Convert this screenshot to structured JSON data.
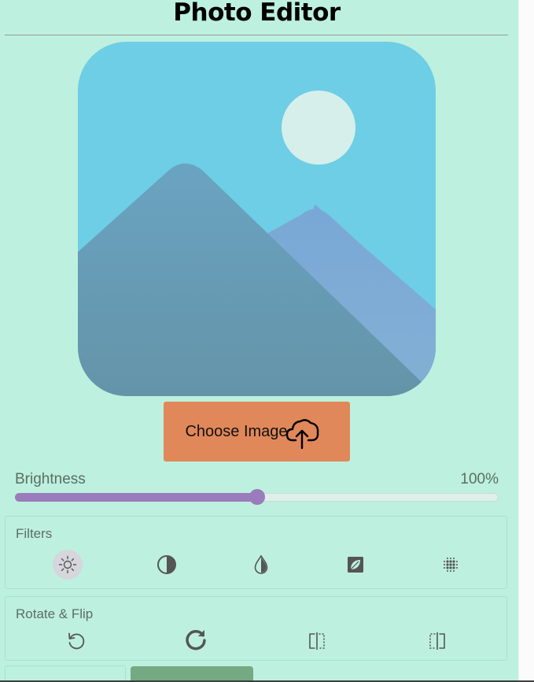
{
  "app": {
    "title": "Photo Editor",
    "background_color": "#bdf0de"
  },
  "preview": {
    "icon": "image-placeholder-icon"
  },
  "choose_image": {
    "label": "Choose Image",
    "icon": "upload-cloud-icon",
    "color": "#e0885a"
  },
  "brightness": {
    "label": "Brightness",
    "value_text": "100%",
    "slider_fraction": 0.5,
    "accent_color": "#9a7bbb"
  },
  "filters": {
    "title": "Filters",
    "buttons": [
      {
        "icon": "brightness-sun-icon",
        "active": true
      },
      {
        "icon": "contrast-icon",
        "active": false
      },
      {
        "icon": "saturation-drop-icon",
        "active": false
      },
      {
        "icon": "invert-icon",
        "active": false
      },
      {
        "icon": "grain-dots-icon",
        "active": false
      }
    ]
  },
  "rotate_flip": {
    "title": "Rotate & Flip",
    "buttons": [
      {
        "icon": "rotate-left-icon"
      },
      {
        "icon": "rotate-right-icon"
      },
      {
        "icon": "flip-horizontal-icon"
      },
      {
        "icon": "flip-vertical-icon"
      }
    ]
  }
}
